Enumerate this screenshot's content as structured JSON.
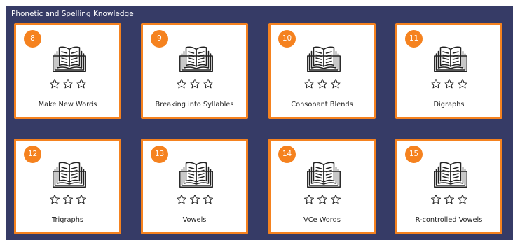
{
  "section": {
    "title": "Phonetic and Spelling Knowledge"
  },
  "colors": {
    "background": "#363b66",
    "accent": "#f5821f",
    "card": "#ffffff"
  },
  "cards": [
    {
      "number": "8",
      "label": "Make New Words",
      "icon": "book-icon",
      "stars_filled": 0,
      "stars_total": 3
    },
    {
      "number": "9",
      "label": "Breaking into Syllables",
      "icon": "book-icon",
      "stars_filled": 0,
      "stars_total": 3
    },
    {
      "number": "10",
      "label": "Consonant Blends",
      "icon": "book-icon",
      "stars_filled": 0,
      "stars_total": 3
    },
    {
      "number": "11",
      "label": "Digraphs",
      "icon": "book-icon",
      "stars_filled": 0,
      "stars_total": 3
    },
    {
      "number": "12",
      "label": "Trigraphs",
      "icon": "book-icon",
      "stars_filled": 0,
      "stars_total": 3
    },
    {
      "number": "13",
      "label": "Vowels",
      "icon": "book-icon",
      "stars_filled": 0,
      "stars_total": 3
    },
    {
      "number": "14",
      "label": "VCe Words",
      "icon": "book-icon",
      "stars_filled": 0,
      "stars_total": 3
    },
    {
      "number": "15",
      "label": "R-controlled Vowels",
      "icon": "book-icon",
      "stars_filled": 0,
      "stars_total": 3
    }
  ]
}
